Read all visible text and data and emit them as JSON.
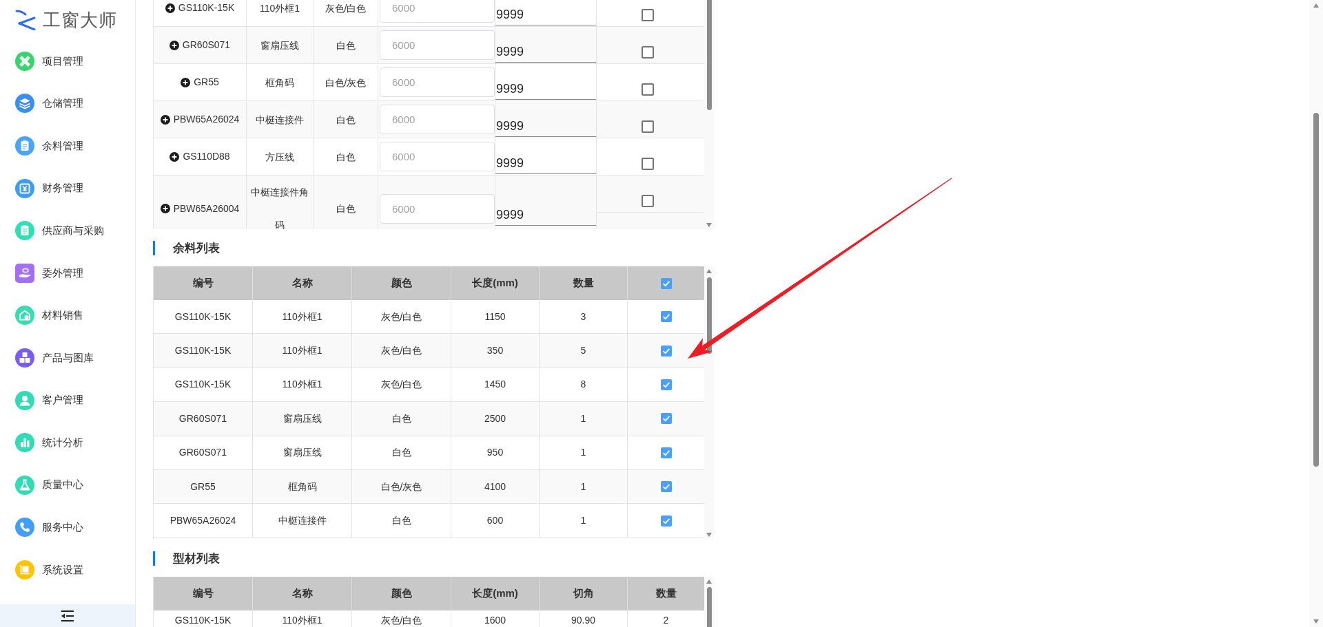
{
  "sidebar": {
    "logo": "工窗大师",
    "items": [
      {
        "label": "项目管理"
      },
      {
        "label": "仓储管理"
      },
      {
        "label": "余料管理"
      },
      {
        "label": "财务管理"
      },
      {
        "label": "供应商与采购"
      },
      {
        "label": "委外管理"
      },
      {
        "label": "材料销售"
      },
      {
        "label": "产品与图库"
      },
      {
        "label": "客户管理"
      },
      {
        "label": "统计分析"
      },
      {
        "label": "质量中心"
      },
      {
        "label": "服务中心"
      },
      {
        "label": "系统设置"
      }
    ]
  },
  "top_table": {
    "rows": [
      {
        "column_1": "GS110K-15K",
        "column_2": "110外框1",
        "column_3": "灰色/白色",
        "column_4": {
          "placeholder": "6000"
        },
        "column_5": {
          "value": "9999"
        },
        "column_6": {
          "checked": false
        }
      },
      {
        "column_1": "GR60S071",
        "column_2": "窗扇压线",
        "column_3": "白色",
        "column_4": {
          "placeholder": "6000"
        },
        "column_5": {
          "value": "9999"
        },
        "column_6": {
          "checked": false
        }
      },
      {
        "column_1": "GR55",
        "column_2": "框角码",
        "column_3": "白色/灰色",
        "column_4": {
          "placeholder": "6000"
        },
        "column_5": {
          "value": "9999"
        },
        "column_6": {
          "checked": false
        }
      },
      {
        "column_1": "PBW65A26024",
        "column_2": "中梃连接件",
        "column_3": "白色",
        "column_4": {
          "placeholder": "6000"
        },
        "column_5": {
          "value": "9999"
        },
        "column_6": {
          "checked": false
        }
      },
      {
        "column_1": "GS110D88",
        "column_2": "方压线",
        "column_3": "白色",
        "column_4": {
          "placeholder": "6000"
        },
        "column_5": {
          "value": "9999"
        },
        "column_6": {
          "checked": false
        }
      },
      {
        "column_1": "PBW65A26004",
        "column_2": "中梃连接件角码",
        "column_3": "白色",
        "column_4": {
          "placeholder": "6000"
        },
        "column_5": {
          "value": "9999"
        },
        "column_6": {
          "checked": false
        }
      }
    ]
  },
  "remnant_list": {
    "title": "余料列表",
    "columns": [
      "编号",
      "名称",
      "颜色",
      "长度(mm)",
      "数量"
    ],
    "select_all": {
      "checked": true
    },
    "rows": [
      {
        "cells": [
          "GS110K-15K",
          "110外框1",
          "灰色/白色",
          "1150",
          "3"
        ],
        "checked": true
      },
      {
        "cells": [
          "GS110K-15K",
          "110外框1",
          "灰色/白色",
          "350",
          "5"
        ],
        "checked": true
      },
      {
        "cells": [
          "GS110K-15K",
          "110外框1",
          "灰色/白色",
          "1450",
          "8"
        ],
        "checked": true
      },
      {
        "cells": [
          "GR60S071",
          "窗扇压线",
          "白色",
          "2500",
          "1"
        ],
        "checked": true
      },
      {
        "cells": [
          "GR60S071",
          "窗扇压线",
          "白色",
          "950",
          "1"
        ],
        "checked": true
      },
      {
        "cells": [
          "GR55",
          "框角码",
          "白色/灰色",
          "4100",
          "1"
        ],
        "checked": true
      },
      {
        "cells": [
          "PBW65A26024",
          "中梃连接件",
          "白色",
          "600",
          "1"
        ],
        "checked": true
      }
    ]
  },
  "profile_list": {
    "title": "型材列表",
    "columns": [
      "编号",
      "名称",
      "颜色",
      "长度(mm)",
      "切角",
      "数量"
    ],
    "rows": [
      {
        "cells": [
          "GS110K-15K",
          "110外框1",
          "灰色/白色",
          "1600",
          "90.90",
          "2"
        ]
      }
    ]
  }
}
